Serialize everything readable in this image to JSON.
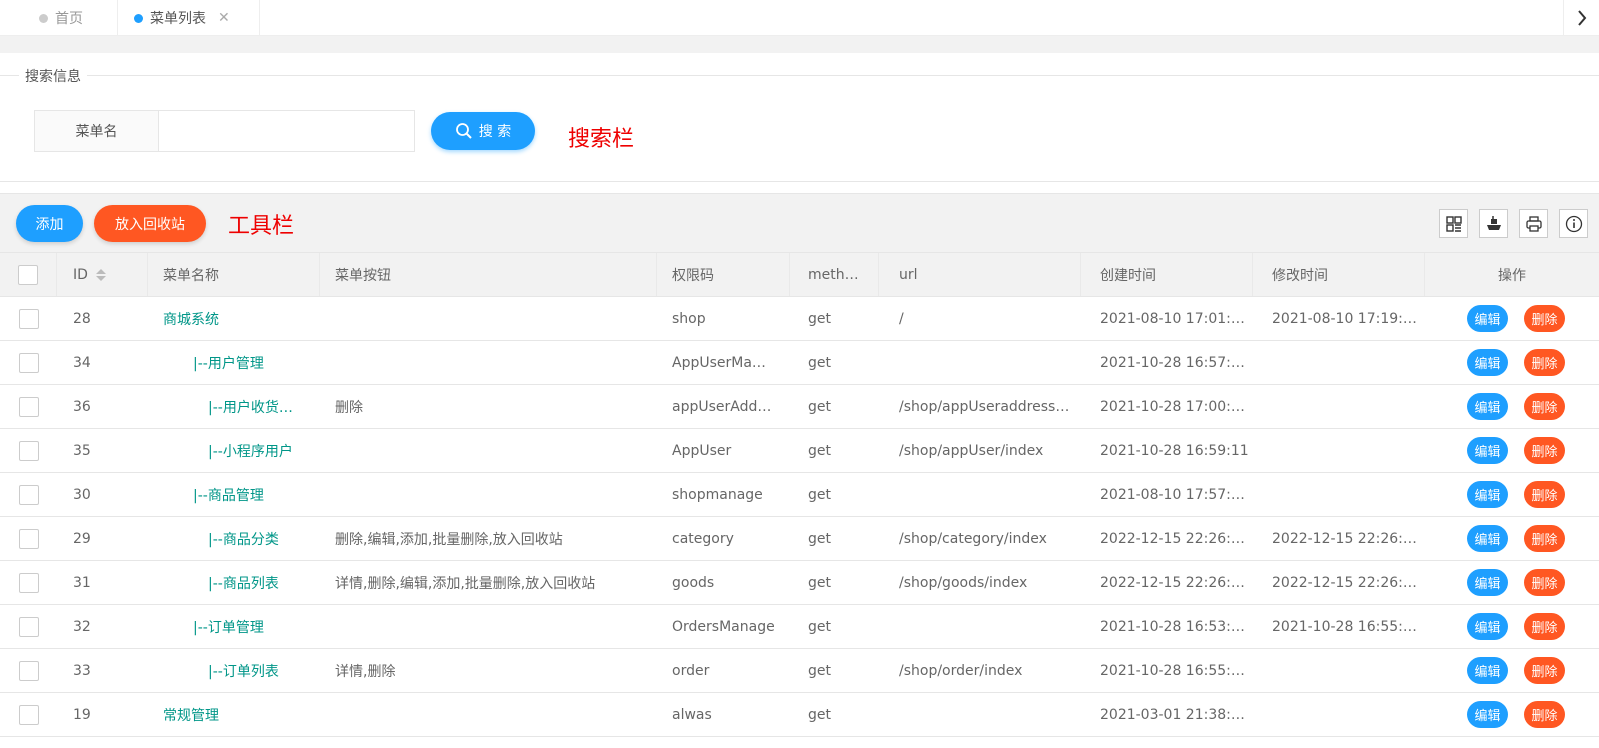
{
  "tabs": {
    "home_label": "首页",
    "menu_label": "菜单列表",
    "close_symbol": "✕",
    "next_symbol": "›"
  },
  "search": {
    "legend": "搜索信息",
    "field_label": "菜单名",
    "field_value": "",
    "field_placeholder": "",
    "button_label": "搜 索",
    "annotation": "搜索栏"
  },
  "toolbar": {
    "add_label": "添加",
    "recycle_label": "放入回收站",
    "annotation": "工具栏",
    "icons": [
      "columns-icon",
      "export-icon",
      "print-icon",
      "info-icon"
    ]
  },
  "colors": {
    "blue": "#1E9FFF",
    "orange": "#FF5722",
    "green": "#009688",
    "annotation_red": "#E00000"
  },
  "table": {
    "headers": {
      "id": "ID",
      "name": "菜单名称",
      "buttons": "菜单按钮",
      "code": "权限码",
      "method": "meth…",
      "url": "url",
      "created": "创建时间",
      "modified": "修改时间",
      "actions": "操作"
    },
    "edit_label": "编辑",
    "delete_label": "删除",
    "rows": [
      {
        "id": "28",
        "name": "商城系统",
        "level": 0,
        "buttons": "",
        "code": "shop",
        "method": "get",
        "url": "/",
        "created": "2021-08-10 17:01:…",
        "modified": "2021-08-10 17:19:…"
      },
      {
        "id": "34",
        "name": "|--用户管理",
        "level": 1,
        "buttons": "",
        "code": "AppUserMa…",
        "method": "get",
        "url": "",
        "created": "2021-10-28 16:57:…",
        "modified": ""
      },
      {
        "id": "36",
        "name": "|--用户收货…",
        "level": 2,
        "buttons": "删除",
        "code": "appUserAdd…",
        "method": "get",
        "url": "/shop/appUseraddress…",
        "created": "2021-10-28 17:00:…",
        "modified": ""
      },
      {
        "id": "35",
        "name": "|--小程序用户",
        "level": 2,
        "buttons": "",
        "code": "AppUser",
        "method": "get",
        "url": "/shop/appUser/index",
        "created": "2021-10-28 16:59:11",
        "modified": ""
      },
      {
        "id": "30",
        "name": "|--商品管理",
        "level": 1,
        "buttons": "",
        "code": "shopmanage",
        "method": "get",
        "url": "",
        "created": "2021-08-10 17:57:…",
        "modified": ""
      },
      {
        "id": "29",
        "name": "|--商品分类",
        "level": 2,
        "buttons": "删除,编辑,添加,批量删除,放入回收站",
        "code": "category",
        "method": "get",
        "url": "/shop/category/index",
        "created": "2022-12-15 22:26:…",
        "modified": "2022-12-15 22:26:…"
      },
      {
        "id": "31",
        "name": "|--商品列表",
        "level": 2,
        "buttons": "详情,删除,编辑,添加,批量删除,放入回收站",
        "code": "goods",
        "method": "get",
        "url": "/shop/goods/index",
        "created": "2022-12-15 22:26:…",
        "modified": "2022-12-15 22:26:…"
      },
      {
        "id": "32",
        "name": "|--订单管理",
        "level": 1,
        "buttons": "",
        "code": "OrdersManage",
        "method": "get",
        "url": "",
        "created": "2021-10-28 16:53:…",
        "modified": "2021-10-28 16:55:…"
      },
      {
        "id": "33",
        "name": "|--订单列表",
        "level": 2,
        "buttons": "详情,删除",
        "code": "order",
        "method": "get",
        "url": "/shop/order/index",
        "created": "2021-10-28 16:55:…",
        "modified": ""
      },
      {
        "id": "19",
        "name": "常规管理",
        "level": 0,
        "buttons": "",
        "code": "alwas",
        "method": "get",
        "url": "",
        "created": "2021-03-01 21:38:…",
        "modified": ""
      }
    ]
  }
}
